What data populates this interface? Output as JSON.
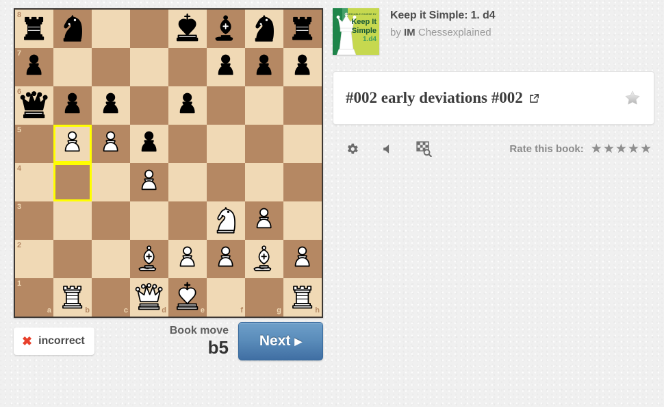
{
  "book": {
    "title": "Keep it Simple: 1. d4",
    "author_prefix": "by",
    "author_title": "IM",
    "author_name": "Chessexplained",
    "cover": {
      "tagline": "CHESSABLE COURSE BY",
      "line1": "Keep It",
      "line2": "Simple",
      "line3": "1.d4"
    }
  },
  "chapter": {
    "title": "#002 early deviations #002",
    "external_link_icon": "external-link-icon",
    "favorite_icon": "star-icon"
  },
  "tools": {
    "settings_icon": "gear-icon",
    "sound_icon": "speaker-muted-icon",
    "analysis_icon": "board-search-icon"
  },
  "rating": {
    "label": "Rate this book:",
    "stars": 5,
    "star_icon": "star-icon"
  },
  "feedback": {
    "status_icon": "x-mark-icon",
    "status_text": "incorrect",
    "book_move_label": "Book move",
    "book_move_value": "b5",
    "next_label": "Next",
    "next_caret": "▶"
  },
  "board": {
    "orientation": "white",
    "files": [
      "a",
      "b",
      "c",
      "d",
      "e",
      "f",
      "g",
      "h"
    ],
    "ranks": [
      "8",
      "7",
      "6",
      "5",
      "4",
      "3",
      "2",
      "1"
    ],
    "light_color": "#f0d9b5",
    "dark_color": "#b58863",
    "highlight_color": "#ffff00",
    "highlighted_squares": [
      "b5",
      "b4"
    ],
    "position": {
      "a8": "black-rook",
      "b8": "black-knight",
      "c8": "",
      "d8": "",
      "e8": "black-king",
      "f8": "black-bishop",
      "g8": "black-knight",
      "h8": "black-rook",
      "a7": "black-pawn",
      "b7": "",
      "c7": "",
      "d7": "",
      "e7": "",
      "f7": "black-pawn",
      "g7": "black-pawn",
      "h7": "black-pawn",
      "a6": "black-queen",
      "b6": "black-pawn",
      "c6": "black-pawn",
      "d6": "",
      "e6": "black-pawn",
      "f6": "",
      "g6": "",
      "h6": "",
      "a5": "",
      "b5": "white-pawn",
      "c5": "white-pawn",
      "d5": "black-pawn",
      "e5": "",
      "f5": "",
      "g5": "",
      "h5": "",
      "a4": "",
      "b4": "",
      "c4": "",
      "d4": "white-pawn",
      "e4": "",
      "f4": "",
      "g4": "",
      "h4": "",
      "a3": "",
      "b3": "",
      "c3": "",
      "d3": "",
      "e3": "",
      "f3": "white-knight",
      "g3": "white-pawn",
      "h3": "",
      "a2": "",
      "b2": "",
      "c2": "",
      "d2": "white-bishop",
      "e2": "white-pawn",
      "f2": "white-pawn",
      "g2": "white-bishop",
      "h2": "white-pawn",
      "a1": "",
      "b1": "white-rook",
      "c1": "",
      "d1": "white-queen",
      "e1": "white-king",
      "f1": "",
      "g1": "",
      "h1": "white-rook"
    }
  }
}
